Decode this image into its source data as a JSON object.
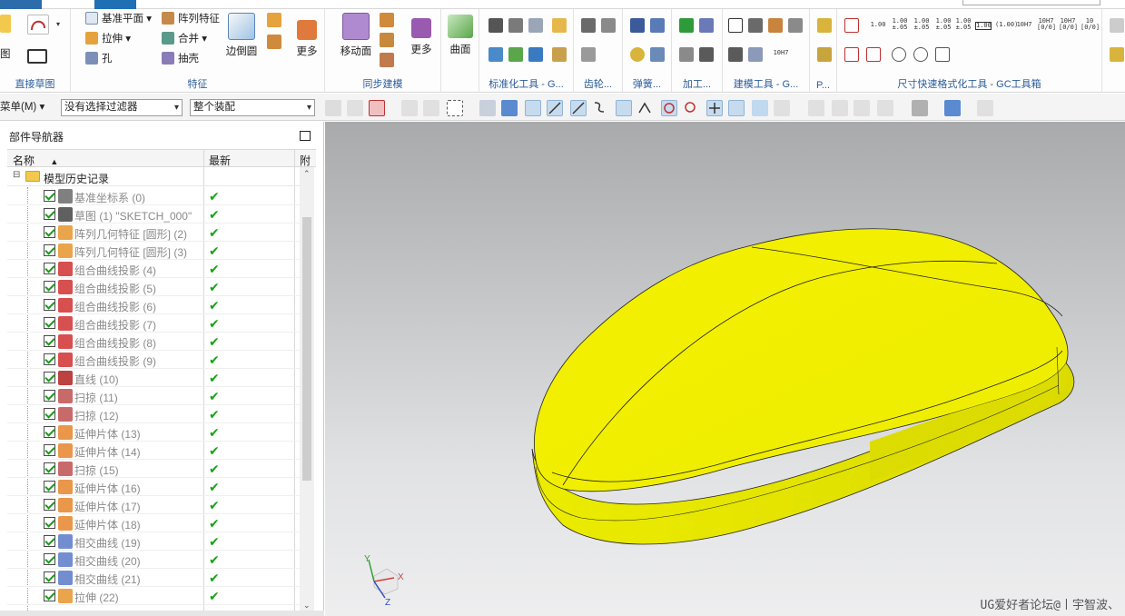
{
  "ribbon": {
    "groups": [
      {
        "label": "直接草图"
      },
      {
        "label": "特征"
      },
      {
        "label": "同步建模"
      },
      {
        "label": "标准化工具 - G..."
      },
      {
        "label": "齿轮..."
      },
      {
        "label": "弹簧..."
      },
      {
        "label": "加工..."
      },
      {
        "label": "建模工具 - G..."
      },
      {
        "label": "P..."
      },
      {
        "label": "尺寸快速格式化工具 - GC工具箱"
      }
    ],
    "sketch_label": "图",
    "feature_items": {
      "datum_plane": "基准平面",
      "array_feature": "阵列特征",
      "extrude": "拉伸",
      "unite": "合并",
      "hole": "孔",
      "shell": "抽壳",
      "edge_blend": "边倒圆",
      "more": "更多"
    },
    "sync_items": {
      "move_face": "移动面",
      "more": "更多"
    },
    "surface_label": "曲面",
    "format_labels": [
      "1.00",
      "1.00 ±.05",
      "1.00 ±.05",
      "1.00 ±.05",
      "1.00 ±.05",
      "1.00",
      "(1.00)",
      "10H7",
      "10H7 [0/0]",
      "10H7 [0/0]",
      "10 [0/0]"
    ],
    "modeling_tool_label": "10H7"
  },
  "toolbar2": {
    "menu_label": "菜单(M)",
    "filter_value": "没有选择过滤器",
    "scope_value": "整个装配"
  },
  "navigator": {
    "title": "部件导航器",
    "columns": [
      "名称",
      "最新",
      "附注"
    ],
    "root": "模型历史记录",
    "items": [
      {
        "name": "基准坐标系 (0)",
        "icon": "datum-csys-icon",
        "up_to_date": "✔"
      },
      {
        "name": "草图 (1) \"SKETCH_000\"",
        "icon": "sketch-icon",
        "up_to_date": "✔"
      },
      {
        "name": "阵列几何特征 [圆形] (2)",
        "icon": "pattern-geometry-icon",
        "up_to_date": "✔"
      },
      {
        "name": "阵列几何特征 [圆形] (3)",
        "icon": "pattern-geometry-icon",
        "up_to_date": "✔"
      },
      {
        "name": "组合曲线投影 (4)",
        "icon": "combined-projection-icon",
        "up_to_date": "✔"
      },
      {
        "name": "组合曲线投影 (5)",
        "icon": "combined-projection-icon",
        "up_to_date": "✔"
      },
      {
        "name": "组合曲线投影 (6)",
        "icon": "combined-projection-icon",
        "up_to_date": "✔"
      },
      {
        "name": "组合曲线投影 (7)",
        "icon": "combined-projection-icon",
        "up_to_date": "✔"
      },
      {
        "name": "组合曲线投影 (8)",
        "icon": "combined-projection-icon",
        "up_to_date": "✔"
      },
      {
        "name": "组合曲线投影 (9)",
        "icon": "combined-projection-icon",
        "up_to_date": "✔"
      },
      {
        "name": "直线 (10)",
        "icon": "line-icon",
        "up_to_date": "✔"
      },
      {
        "name": "扫掠 (11)",
        "icon": "swept-icon",
        "up_to_date": "✔"
      },
      {
        "name": "扫掠 (12)",
        "icon": "swept-icon",
        "up_to_date": "✔"
      },
      {
        "name": "延伸片体 (13)",
        "icon": "extend-sheet-icon",
        "up_to_date": "✔"
      },
      {
        "name": "延伸片体 (14)",
        "icon": "extend-sheet-icon",
        "up_to_date": "✔"
      },
      {
        "name": "扫掠 (15)",
        "icon": "swept-icon",
        "up_to_date": "✔"
      },
      {
        "name": "延伸片体 (16)",
        "icon": "extend-sheet-icon",
        "up_to_date": "✔"
      },
      {
        "name": "延伸片体 (17)",
        "icon": "extend-sheet-icon",
        "up_to_date": "✔"
      },
      {
        "name": "延伸片体 (18)",
        "icon": "extend-sheet-icon",
        "up_to_date": "✔"
      },
      {
        "name": "相交曲线 (19)",
        "icon": "intersection-curve-icon",
        "up_to_date": "✔"
      },
      {
        "name": "相交曲线 (20)",
        "icon": "intersection-curve-icon",
        "up_to_date": "✔"
      },
      {
        "name": "相交曲线 (21)",
        "icon": "intersection-curve-icon",
        "up_to_date": "✔"
      },
      {
        "name": "拉伸 (22)",
        "icon": "extrude-icon",
        "up_to_date": "✔"
      }
    ]
  },
  "viewport": {
    "triad": {
      "x": "X",
      "y": "Y",
      "z": "Z"
    },
    "watermark": "UG爱好者论坛@丨宇智波、",
    "model_color": "#f5f000"
  },
  "colors": {
    "accent": "#1f6fb5",
    "group_label": "#2a5c9a",
    "check_green": "#17a317"
  }
}
